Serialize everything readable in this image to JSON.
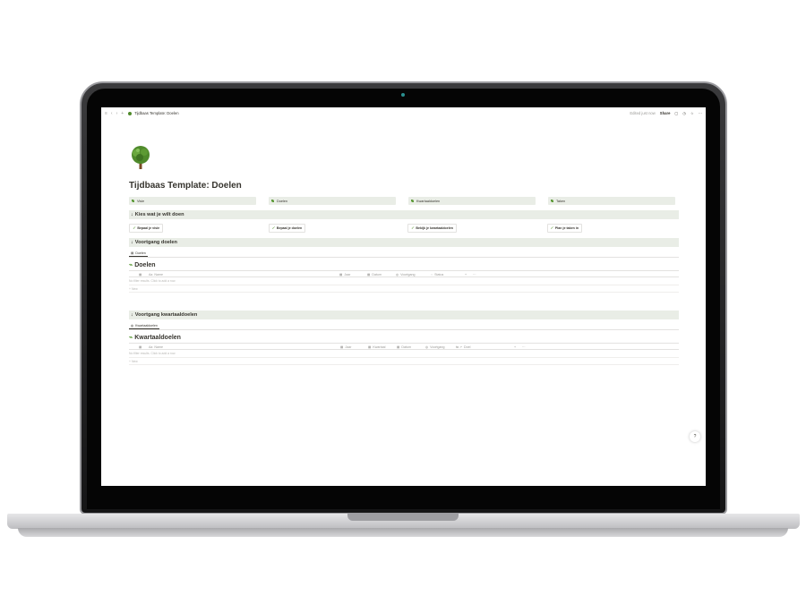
{
  "topbar": {
    "breadcrumb": "Tijdbaas Template: Doelen",
    "edited": "Edited just now",
    "share": "Share"
  },
  "page": {
    "title": "Tijdbaas Template: Doelen",
    "links": [
      "Visie",
      "Doelen",
      "Kwartaaldoelen",
      "Taken"
    ]
  },
  "section1": {
    "heading": "Kies wat je wilt doen",
    "buttons": [
      "Bepaal je visie",
      "Bepaal je doelen",
      "Bekijk je kwartaaldoelen",
      "Plan je taken in"
    ]
  },
  "section2": {
    "heading": "Voortgang doelen",
    "tab": "Doelen",
    "db_title": "Doelen",
    "columns": [
      "Name",
      "Jaar",
      "Datum",
      "Voortgang",
      "Status"
    ],
    "empty": "No filter results. Click to add a row.",
    "new": "New"
  },
  "section3": {
    "heading": "Voortgang kwartaaldoelen",
    "tab": "Kwartaaldoelen",
    "db_title": "Kwartaaldoelen",
    "columns": [
      "Name",
      "Jaar",
      "Kwartaal",
      "Datum",
      "Voortgang",
      "Doel"
    ],
    "empty": "No filter results. Click to add a row.",
    "new": "New"
  },
  "help": "?"
}
